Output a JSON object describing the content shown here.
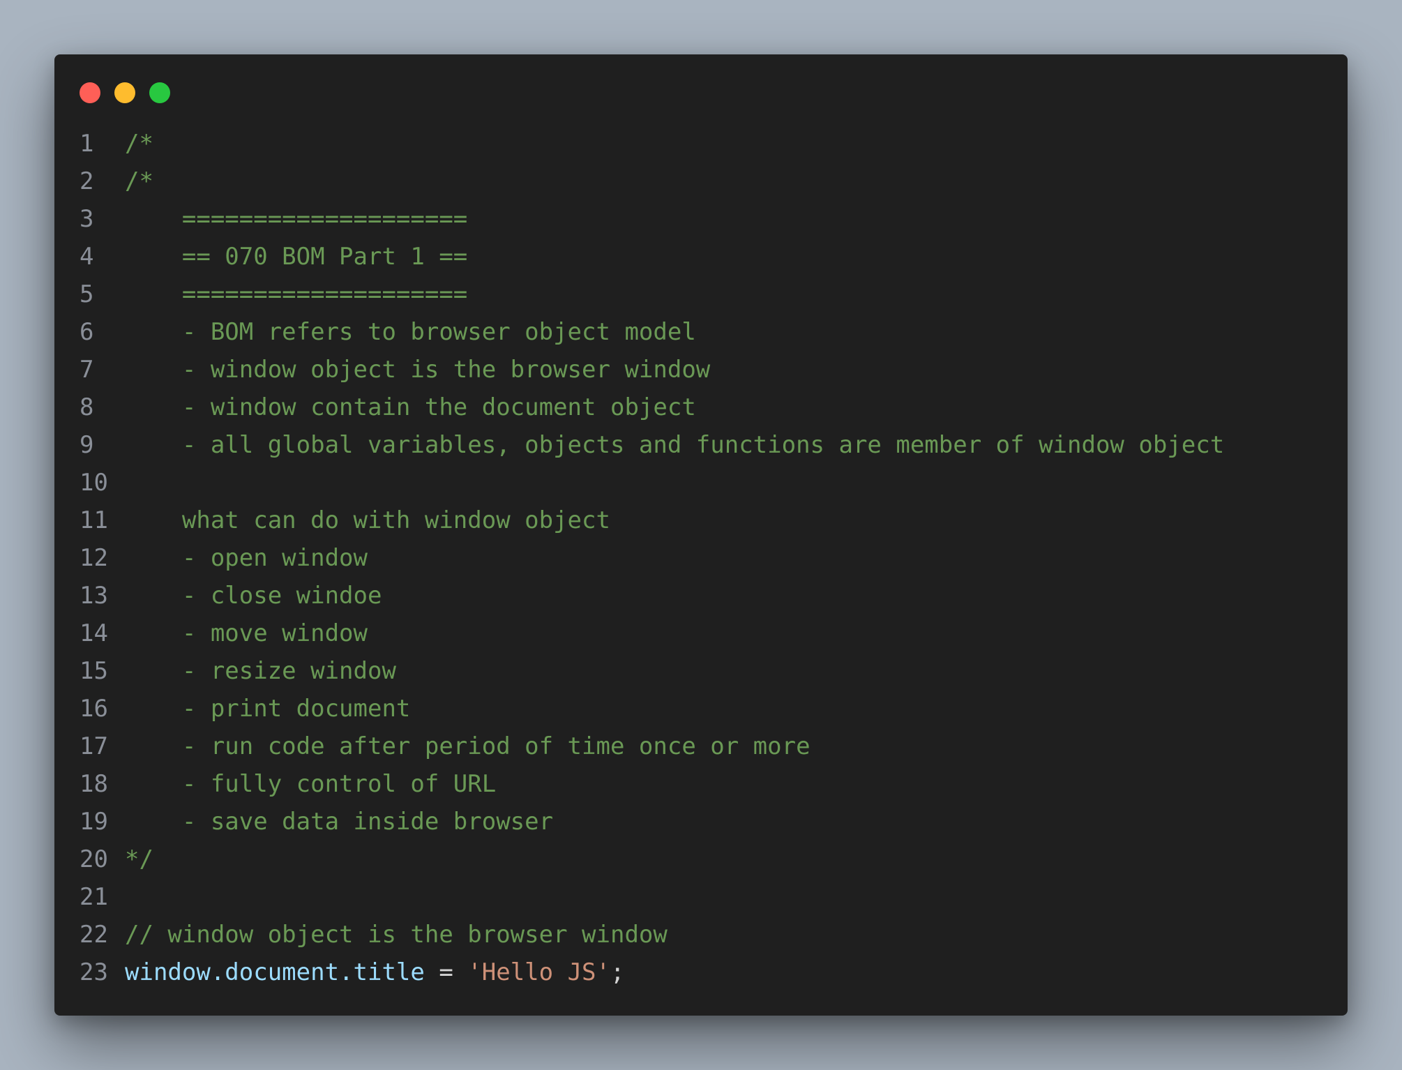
{
  "window_controls": {
    "close_color": "#ff5f57",
    "minimize_color": "#febc2e",
    "maximize_color": "#28c840"
  },
  "code_lines": [
    {
      "n": "1",
      "text": "/*"
    },
    {
      "n": "2",
      "text": "/*"
    },
    {
      "n": "3",
      "text": "    ===================="
    },
    {
      "n": "4",
      "text": "    == 070 BOM Part 1 =="
    },
    {
      "n": "5",
      "text": "    ===================="
    },
    {
      "n": "6",
      "text": "    - BOM refers to browser object model"
    },
    {
      "n": "7",
      "text": "    - window object is the browser window"
    },
    {
      "n": "8",
      "text": "    - window contain the document object"
    },
    {
      "n": "9",
      "text": "    - all global variables, objects and functions are member of window object"
    },
    {
      "n": "10",
      "text": ""
    },
    {
      "n": "11",
      "text": "    what can do with window object"
    },
    {
      "n": "12",
      "text": "    - open window"
    },
    {
      "n": "13",
      "text": "    - close windoe"
    },
    {
      "n": "14",
      "text": "    - move window"
    },
    {
      "n": "15",
      "text": "    - resize window"
    },
    {
      "n": "16",
      "text": "    - print document"
    },
    {
      "n": "17",
      "text": "    - run code after period of time once or more"
    },
    {
      "n": "18",
      "text": "    - fully control of URL"
    },
    {
      "n": "19",
      "text": "    - save data inside browser"
    },
    {
      "n": "20",
      "text": "*/"
    },
    {
      "n": "21",
      "text": ""
    },
    {
      "n": "22",
      "text": "// window object is the browser window"
    },
    {
      "n": "23",
      "tokens": [
        {
          "t": "window.document.title",
          "k": "var"
        },
        {
          "t": " = ",
          "k": "op"
        },
        {
          "t": "'Hello JS'",
          "k": "str"
        },
        {
          "t": ";",
          "k": "op"
        }
      ]
    }
  ],
  "colors": {
    "comment": "#6a9955",
    "variable": "#9cdcfe",
    "string": "#ce9178",
    "operator": "#d4d4d4",
    "line_number": "#8a8f98",
    "editor_bg": "#1f1f1f",
    "page_bg": "#a9b4c0"
  }
}
